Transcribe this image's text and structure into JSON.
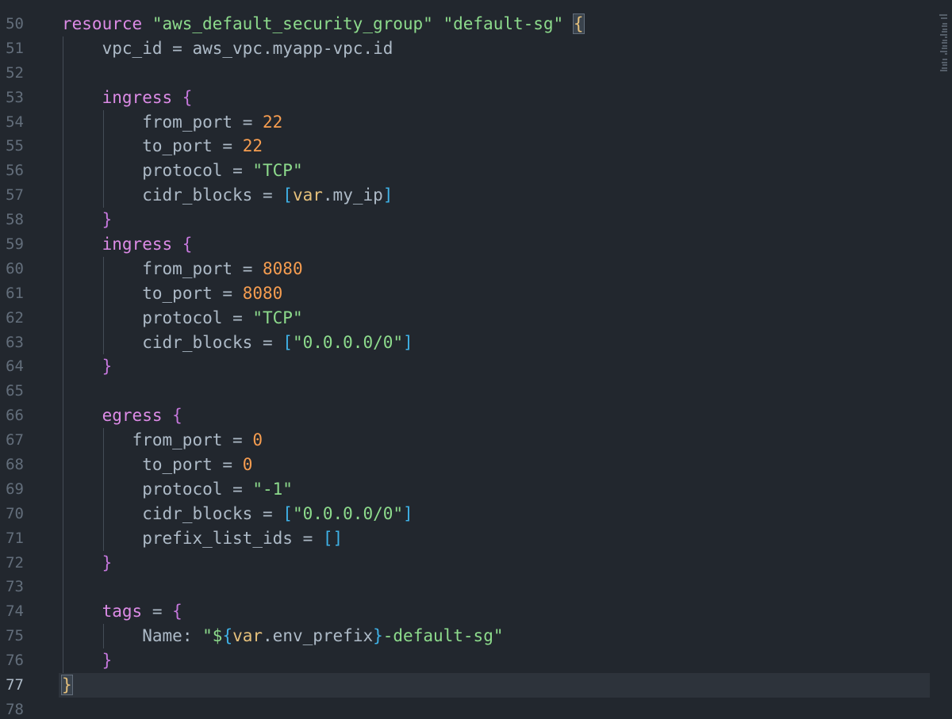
{
  "editor": {
    "language": "terraform",
    "current_line": "77",
    "colors": {
      "background": "#22272e",
      "line_number": "#636e7b",
      "keyword": "#dc8be6",
      "string": "#8ddb8c",
      "number": "#f69d50",
      "bracket_curly": "#c678dd",
      "bracket_square": "#3fb2e7"
    },
    "lines": [
      {
        "n": "50",
        "text": "resource \"aws_default_security_group\" \"default-sg\" {"
      },
      {
        "n": "51",
        "text": "    vpc_id = aws_vpc.myapp-vpc.id"
      },
      {
        "n": "52",
        "text": ""
      },
      {
        "n": "53",
        "text": "    ingress {"
      },
      {
        "n": "54",
        "text": "        from_port = 22"
      },
      {
        "n": "55",
        "text": "        to_port = 22"
      },
      {
        "n": "56",
        "text": "        protocol = \"TCP\""
      },
      {
        "n": "57",
        "text": "        cidr_blocks = [var.my_ip]"
      },
      {
        "n": "58",
        "text": "    }"
      },
      {
        "n": "59",
        "text": "    ingress {"
      },
      {
        "n": "60",
        "text": "        from_port = 8080"
      },
      {
        "n": "61",
        "text": "        to_port = 8080"
      },
      {
        "n": "62",
        "text": "        protocol = \"TCP\""
      },
      {
        "n": "63",
        "text": "        cidr_blocks = [\"0.0.0.0/0\"]"
      },
      {
        "n": "64",
        "text": "    }"
      },
      {
        "n": "65",
        "text": ""
      },
      {
        "n": "66",
        "text": "    egress {"
      },
      {
        "n": "67",
        "text": "       from_port = 0"
      },
      {
        "n": "68",
        "text": "        to_port = 0"
      },
      {
        "n": "69",
        "text": "        protocol = \"-1\""
      },
      {
        "n": "70",
        "text": "        cidr_blocks = [\"0.0.0.0/0\"]"
      },
      {
        "n": "71",
        "text": "        prefix_list_ids = []"
      },
      {
        "n": "72",
        "text": "    }"
      },
      {
        "n": "73",
        "text": ""
      },
      {
        "n": "74",
        "text": "    tags = {"
      },
      {
        "n": "75",
        "text": "        Name: \"${var.env_prefix}-default-sg\""
      },
      {
        "n": "76",
        "text": "    }"
      },
      {
        "n": "77",
        "text": "}"
      },
      {
        "n": "78",
        "text": ""
      }
    ]
  }
}
